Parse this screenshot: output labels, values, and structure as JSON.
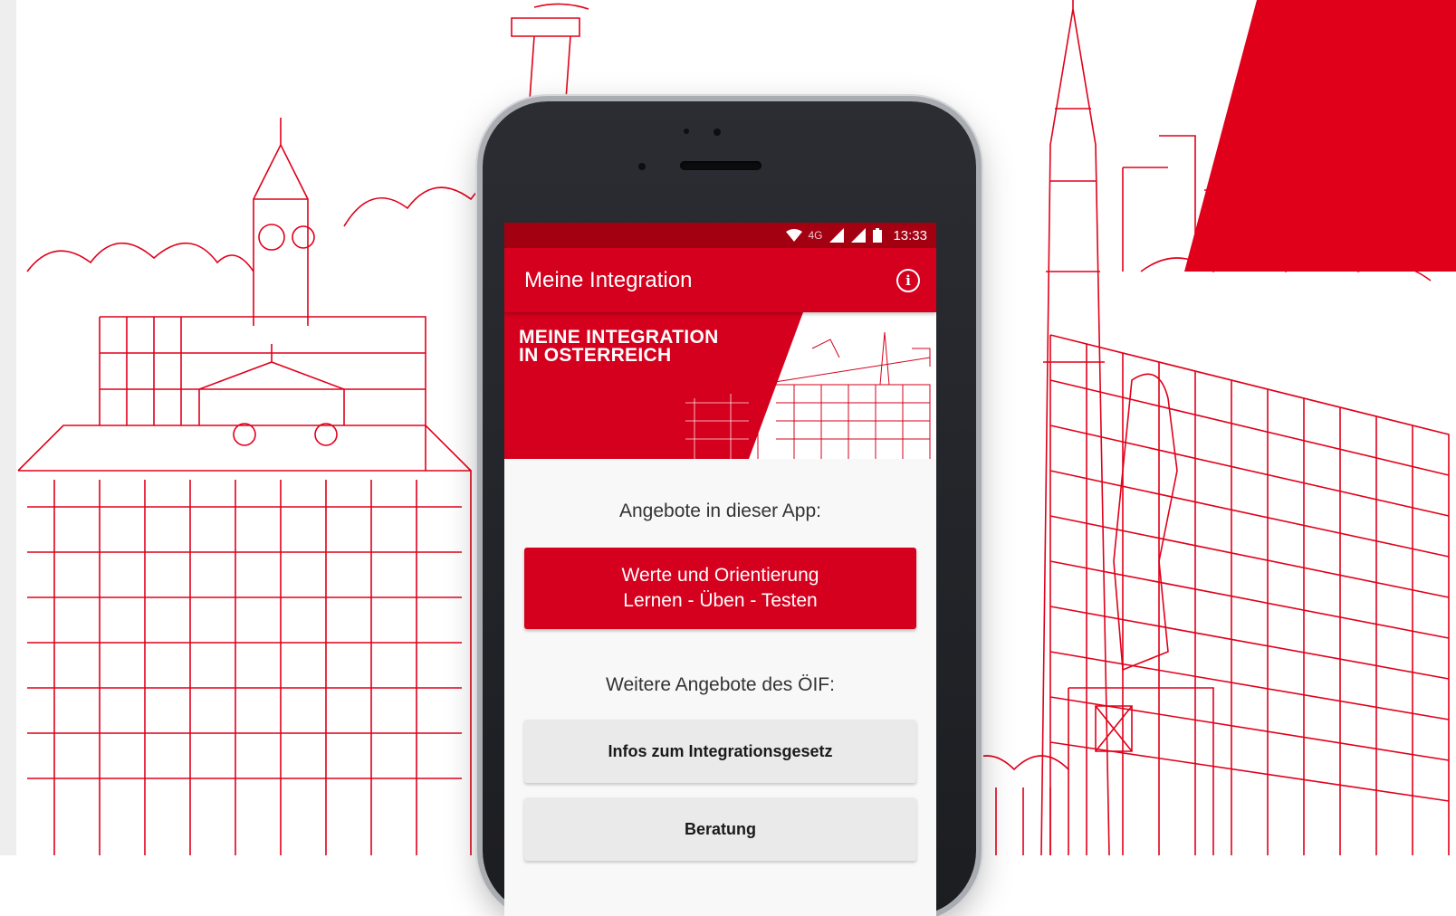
{
  "statusbar": {
    "network": "4G",
    "time": "13:33"
  },
  "appbar": {
    "title": "Meine Integration",
    "info_icon": "info-icon"
  },
  "banner": {
    "line1": "MEINE INTEGRATION",
    "line2": "IN OSTERREICH"
  },
  "main": {
    "offers_label": "Angebote in dieser App:",
    "primary_button": {
      "line1": "Werte und Orientierung",
      "line2": "Lernen - Üben - Testen"
    },
    "more_label": "Weitere Angebote des ÖIF:",
    "buttons": [
      {
        "label": "Infos zum Integrationsgesetz"
      },
      {
        "label": "Beratung"
      }
    ]
  },
  "colors": {
    "brand_red": "#d4001e",
    "status_red": "#a30012",
    "line_red": "#e1001a"
  }
}
